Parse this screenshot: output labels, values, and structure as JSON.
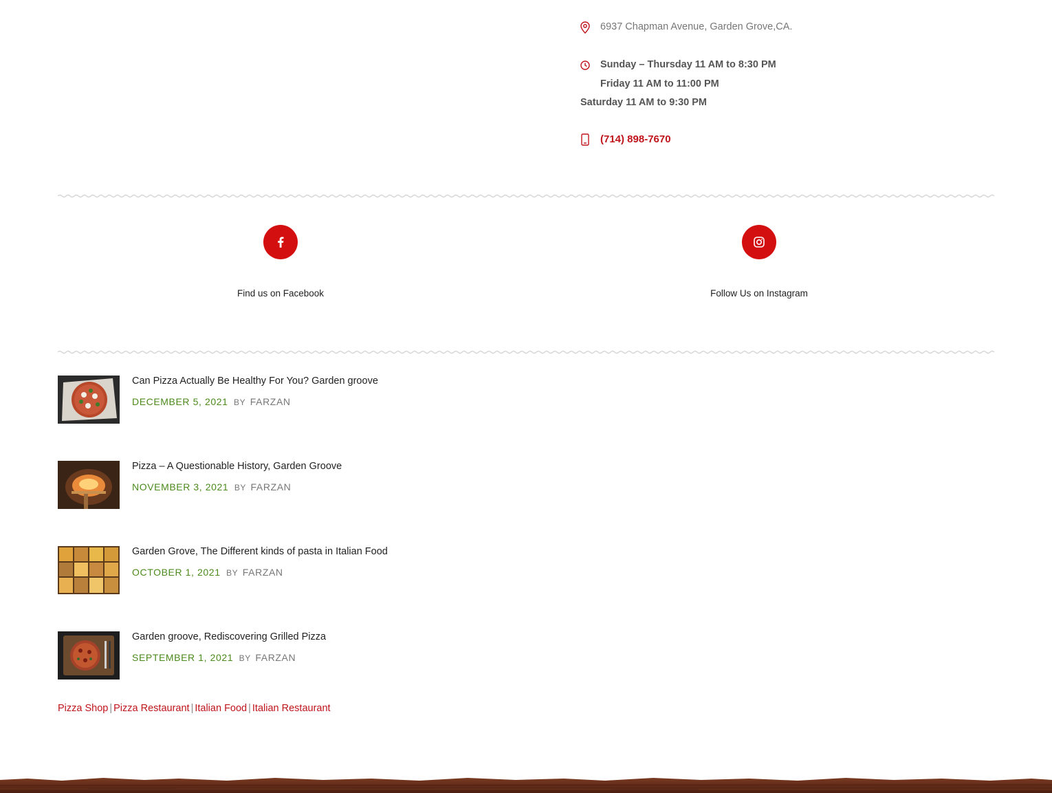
{
  "contact": {
    "address": "6937 Chapman Avenue, Garden Grove,CA.",
    "hours_line1": "Sunday – Thursday 11 AM to 8:30 PM",
    "hours_line2": "Friday 11 AM to 11:00 PM",
    "hours_line3": "Saturday 11 AM to 9:30 PM",
    "phone": "(714) 898-7670",
    "icons": [
      "map-pin-icon",
      "clock-icon",
      "phone-icon"
    ]
  },
  "social": [
    {
      "label": "Find us on Facebook",
      "icon": "facebook-icon"
    },
    {
      "label": "Follow Us on Instagram",
      "icon": "instagram-icon"
    }
  ],
  "posts": [
    {
      "title": "Can Pizza Actually Be Healthy For You? Garden groove",
      "date": "December 5, 2021",
      "by": "by",
      "author": "Farzan"
    },
    {
      "title": "Pizza – A Questionable History, Garden Groove",
      "date": "November 3, 2021",
      "by": "by",
      "author": "Farzan"
    },
    {
      "title": "Garden Grove, The Different kinds of pasta in Italian Food",
      "date": "October 1, 2021",
      "by": "by",
      "author": "Farzan"
    },
    {
      "title": "Garden groove, Rediscovering Grilled Pizza",
      "date": "September 1, 2021",
      "by": "by",
      "author": "Farzan"
    }
  ],
  "tags": {
    "items": [
      "Pizza Shop",
      "Pizza Restaurant",
      "Italian Food",
      "Italian Restaurant"
    ],
    "separator": "|"
  },
  "colors": {
    "accent_red": "#d40f10",
    "link_red": "#c0141b",
    "date_green": "#4c8a1c",
    "footer_brown": "#5a2a18"
  }
}
